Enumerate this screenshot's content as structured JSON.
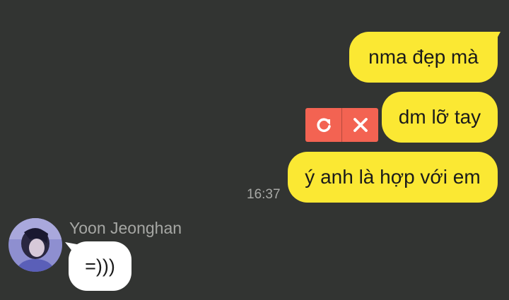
{
  "messages_out": [
    {
      "text": "nma đẹp mà"
    },
    {
      "text": "dm lỡ tay"
    },
    {
      "text": "ý anh là hợp với em"
    }
  ],
  "timestamp": "16:37",
  "failed_actions": {
    "retry_icon": "refresh-icon",
    "delete_icon": "close-icon"
  },
  "contact": {
    "name": "Yoon Jeonghan"
  },
  "message_in": {
    "text": "=)))"
  },
  "colors": {
    "background": "#323432",
    "outgoing_bubble": "#fbe833",
    "incoming_bubble": "#ffffff",
    "failed_badge": "#f36352"
  }
}
